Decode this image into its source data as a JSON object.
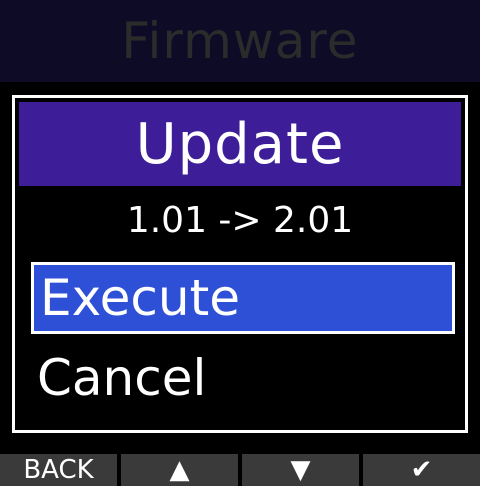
{
  "background": {
    "title": "Firmware"
  },
  "dialog": {
    "title": "Update",
    "version": "1.01 -> 2.01",
    "options": [
      "Execute",
      "Cancel"
    ],
    "selected_index": 0
  },
  "softkeys": {
    "back_label": "BACK",
    "up_icon": "▲",
    "down_icon": "▼",
    "confirm_icon": "✔"
  },
  "colors": {
    "dialog_title_bg": "#3e1e98",
    "selected_bg": "#2e50d6",
    "softkey_bg": "#3a3a3a"
  }
}
